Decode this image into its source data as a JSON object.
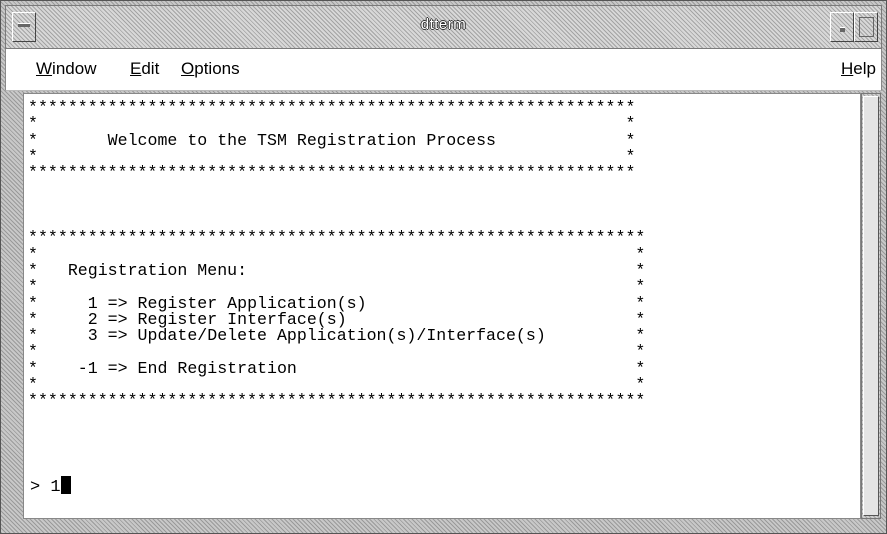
{
  "window": {
    "title": "dtterm"
  },
  "menubar": {
    "items": [
      {
        "mnemonic": "W",
        "rest": "indow"
      },
      {
        "mnemonic": "E",
        "rest": "dit"
      },
      {
        "mnemonic": "O",
        "rest": "ptions"
      }
    ],
    "help": {
      "mnemonic": "H",
      "rest": "elp"
    }
  },
  "terminal": {
    "lines": [
      "*************************************************************",
      "*                                                           *",
      "*       Welcome to the TSM Registration Process             *",
      "*                                                           *",
      "*************************************************************",
      "",
      "",
      "",
      "**************************************************************",
      "*                                                            *",
      "*   Registration Menu:                                       *",
      "*                                                            *",
      "*     1 => Register Application(s)                           *",
      "*     2 => Register Interface(s)                             *",
      "*     3 => Update/Delete Application(s)/Interface(s)         *",
      "*                                                            *",
      "*    -1 => End Registration                                  *",
      "*                                                            *",
      "**************************************************************"
    ],
    "prompt": "> ",
    "input": "1"
  }
}
